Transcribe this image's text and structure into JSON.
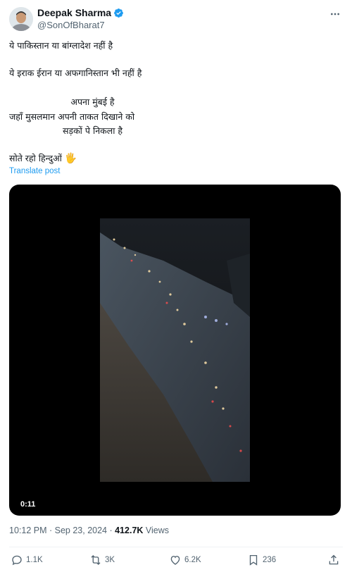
{
  "author": {
    "display_name": "Deepak Sharma",
    "handle": "@SonOfBharat7",
    "verified": true
  },
  "post": {
    "lines": [
      "ये पाकिस्तान या बांग्लादेश नहीं है",
      "ये इराक ईरान या अफगानिस्तान भी नहीं है",
      "अपना मुंबई है",
      "जहाँ मुसलमान अपनी ताकत दिखाने को",
      "सड़कों पे निकला है",
      "सोते रहो हिन्दुओं"
    ],
    "emoji": "🖐",
    "translate_label": "Translate post"
  },
  "video": {
    "duration": "0:11"
  },
  "meta": {
    "time": "10:12 PM",
    "separator": " · ",
    "date": "Sep 23, 2024",
    "views_count": "412.7K",
    "views_label": " Views"
  },
  "actions": {
    "replies": "1.1K",
    "reposts": "3K",
    "likes": "6.2K",
    "bookmarks": "236"
  },
  "colors": {
    "text": "#0f1419",
    "secondary": "#536471",
    "link": "#1d9bf0",
    "verified": "#1d9bf0"
  },
  "icons": [
    "more-icon",
    "verified-icon",
    "reply-icon",
    "repost-icon",
    "like-icon",
    "bookmark-icon",
    "share-icon"
  ]
}
